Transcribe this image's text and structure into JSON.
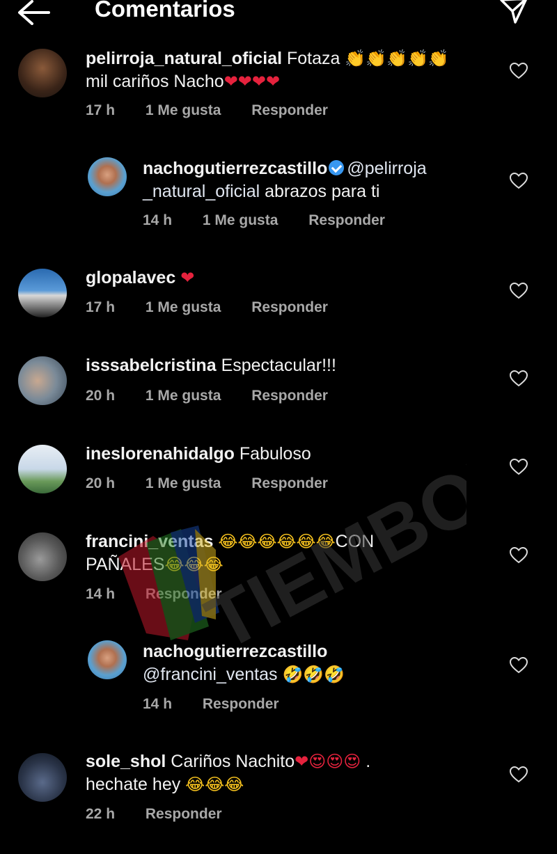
{
  "header": {
    "title": "Comentarios"
  },
  "comments": [
    {
      "user": "pelirroja_natural_oficial",
      "text": "Fotaza",
      "emoji": "👏👏👏👏👏",
      "line2": "mil cariños Nacho",
      "line2_emoji": "❤❤❤❤",
      "time": "17 h",
      "likes": "1 Me gusta",
      "reply": "Responder",
      "avatar_color": "#5a3a2a"
    },
    {
      "user": "nachogutierrezcastillo",
      "mention": "@pelirroja",
      "line2_mention": "_natural_oficial",
      "line2": " abrazos para ti",
      "time": "14 h",
      "likes": "1 Me gusta",
      "reply": "Responder",
      "avatar_color": "#5aa0d0"
    },
    {
      "user": "glopalavec",
      "emoji": "❤",
      "time": "17 h",
      "likes": "1 Me gusta",
      "reply": "Responder",
      "avatar_color": "#4a7fb5"
    },
    {
      "user": "isssabelcristina",
      "text": "Espectacular!!!",
      "time": "20 h",
      "likes": "1 Me gusta",
      "reply": "Responder",
      "avatar_color": "#8a9aa8"
    },
    {
      "user": "ineslorenahidalgo",
      "text": "Fabuloso",
      "time": "20 h",
      "likes": "1 Me gusta",
      "reply": "Responder",
      "avatar_color": "#9ab8d8"
    },
    {
      "user": "francini_ventas",
      "emoji": "😂😂😂😂😂😂",
      "text_after": "CON",
      "line2": "PAÑALES",
      "line2_emoji": "😂😂😂",
      "time": "14 h",
      "reply": "Responder",
      "avatar_color": "#6a6a6a"
    },
    {
      "user": "nachogutierrezcastillo",
      "line2_mention": "@francini_ventas",
      "line2_emoji": "🤣🤣🤣",
      "time": "14 h",
      "reply": "Responder",
      "avatar_color": "#5aa0d0"
    },
    {
      "user": "sole_shol",
      "text": "Cariños Nachito",
      "emoji": "❤😍😍😍",
      "text_after": ".",
      "line2": "hechate hey",
      "line2_emoji": "😂😂😂",
      "time": "22 h",
      "reply": "Responder",
      "avatar_color": "#1a2a3a"
    }
  ],
  "watermark": {
    "text": "TIEMBOX"
  },
  "colors": {
    "background": "#000000",
    "meta": "#a8a8a8",
    "verified": "#3897f0"
  }
}
